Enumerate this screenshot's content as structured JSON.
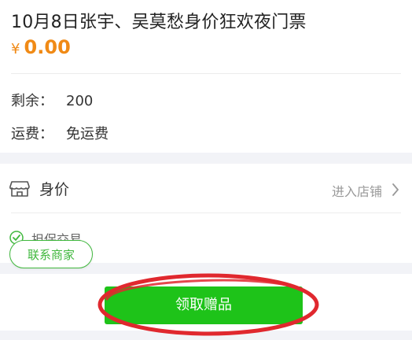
{
  "product": {
    "title": "10月8日张宇、吴莫愁身价狂欢夜门票",
    "currency_symbol": "¥",
    "price": "0.00",
    "stock_label": "剩余：",
    "stock_value": "200",
    "shipping_label": "运费：",
    "shipping_value": "免运费"
  },
  "store": {
    "icon": "store-icon",
    "name": "身价",
    "enter_label": "进入店铺",
    "guarantee_icon": "check-circle-icon",
    "guarantee_label": "担保交易"
  },
  "actions": {
    "contact_label": "联系商家",
    "claim_gift_label": "领取赠品"
  },
  "colors": {
    "price": "#f08a16",
    "primary_green": "#1ec319",
    "outline_green": "#40b83e",
    "annotation_red": "#e0282e",
    "background_gray": "#f2f3f7"
  }
}
